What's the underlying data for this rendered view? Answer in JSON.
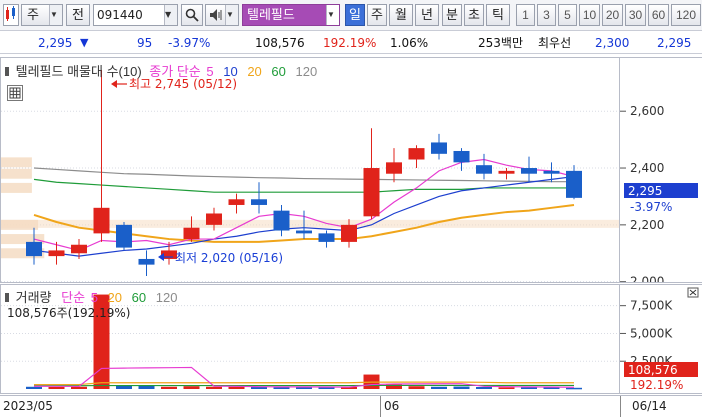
{
  "toolbar": {
    "market": "주",
    "prev_label": "전",
    "code_value": "091440",
    "stock_name": "텔레필드",
    "periods": [
      "일",
      "주",
      "월",
      "년",
      "분",
      "초",
      "틱"
    ],
    "selected_period": "일",
    "minutes": [
      "1",
      "3",
      "5",
      "10",
      "20",
      "30",
      "60",
      "120"
    ]
  },
  "quote": {
    "price": "2,295",
    "change": "95",
    "change_pct": "-3.97%",
    "volume": "108,576",
    "vol_ratio": "192.19%",
    "turnover": "1.06%",
    "amount": "253백만",
    "bid_label": "최우선",
    "bid": "2,300",
    "ask": "2,295"
  },
  "price_panel": {
    "legend_title": "텔레필드 매물대 수(10)",
    "legend_ma_label": "종가 단순",
    "ma_periods": [
      "5",
      "10",
      "20",
      "60",
      "120"
    ],
    "ma_colors": [
      "#e73bd1",
      "#1d3fcf",
      "#f0a51a",
      "#1f9c39",
      "#8c8c8c"
    ],
    "high_annotation": "최고 2,745 (05/12)",
    "low_annotation": "최저 2,020 (05/16)",
    "axis_ticks": [
      "2,600",
      "2,400",
      "2,200",
      "2,000"
    ],
    "current_price_tag": "2,295",
    "current_pct": "-3.97%"
  },
  "volume_panel": {
    "legend_title": "거래량",
    "legend_ma_label": "단순",
    "ma_periods": [
      "5",
      "20",
      "60",
      "120"
    ],
    "ma_colors": [
      "#e73bd1",
      "#f0a51a",
      "#1f9c39",
      "#8c8c8c"
    ],
    "current_volume_text": "108,576주(192.19%)",
    "axis_ticks": [
      "7,500K",
      "5,000K",
      "2,500K"
    ],
    "current_volume_tag": "108,576",
    "current_volume_pct": "192.19%"
  },
  "date_axis": {
    "labels": [
      "2023/05",
      "06"
    ],
    "last_date": "06/14"
  },
  "colors": {
    "up": "#e0231b",
    "down": "#1a5fc9",
    "accent": "#3b6fd8",
    "volume_profile": "#f5dcc3"
  },
  "chart_data": {
    "type": "candlestick",
    "price_axis_ticks": [
      2000,
      2200,
      2400,
      2600
    ],
    "candles": [
      {
        "o": 2140,
        "h": 2190,
        "l": 2060,
        "c": 2090
      },
      {
        "o": 2090,
        "h": 2140,
        "l": 2060,
        "c": 2110
      },
      {
        "o": 2100,
        "h": 2150,
        "l": 2080,
        "c": 2130
      },
      {
        "o": 2170,
        "h": 2745,
        "l": 2140,
        "c": 2260
      },
      {
        "o": 2200,
        "h": 2210,
        "l": 2110,
        "c": 2120
      },
      {
        "o": 2080,
        "h": 2110,
        "l": 2020,
        "c": 2060
      },
      {
        "o": 2080,
        "h": 2140,
        "l": 2060,
        "c": 2110
      },
      {
        "o": 2150,
        "h": 2230,
        "l": 2140,
        "c": 2190
      },
      {
        "o": 2200,
        "h": 2260,
        "l": 2180,
        "c": 2240
      },
      {
        "o": 2270,
        "h": 2310,
        "l": 2240,
        "c": 2290
      },
      {
        "o": 2290,
        "h": 2350,
        "l": 2240,
        "c": 2270
      },
      {
        "o": 2250,
        "h": 2270,
        "l": 2160,
        "c": 2180
      },
      {
        "o": 2180,
        "h": 2250,
        "l": 2150,
        "c": 2170
      },
      {
        "o": 2170,
        "h": 2180,
        "l": 2120,
        "c": 2140
      },
      {
        "o": 2140,
        "h": 2220,
        "l": 2120,
        "c": 2200
      },
      {
        "o": 2230,
        "h": 2540,
        "l": 2220,
        "c": 2400
      },
      {
        "o": 2380,
        "h": 2470,
        "l": 2350,
        "c": 2420
      },
      {
        "o": 2430,
        "h": 2480,
        "l": 2400,
        "c": 2470
      },
      {
        "o": 2490,
        "h": 2520,
        "l": 2430,
        "c": 2450
      },
      {
        "o": 2460,
        "h": 2470,
        "l": 2390,
        "c": 2420
      },
      {
        "o": 2410,
        "h": 2450,
        "l": 2360,
        "c": 2380
      },
      {
        "o": 2380,
        "h": 2400,
        "l": 2360,
        "c": 2390
      },
      {
        "o": 2400,
        "h": 2440,
        "l": 2350,
        "c": 2380
      },
      {
        "o": 2390,
        "h": 2420,
        "l": 2350,
        "c": 2380
      },
      {
        "o": 2390,
        "h": 2410,
        "l": 2290,
        "c": 2295
      }
    ],
    "ma5": [
      2150,
      2130,
      2110,
      2145,
      2140,
      2145,
      2130,
      2150,
      2150,
      2190,
      2230,
      2240,
      2230,
      2205,
      2190,
      2220,
      2280,
      2330,
      2390,
      2420,
      2430,
      2410,
      2395,
      2390,
      2370
    ],
    "ma10": [
      2110,
      2100,
      2090,
      2100,
      2110,
      2115,
      2125,
      2135,
      2150,
      2160,
      2175,
      2185,
      2190,
      2185,
      2180,
      2200,
      2240,
      2270,
      2300,
      2320,
      2330,
      2340,
      2350,
      2360,
      2370
    ],
    "ma20": [
      2235,
      2210,
      2190,
      2180,
      2170,
      2160,
      2150,
      2145,
      2140,
      2140,
      2140,
      2145,
      2150,
      2150,
      2150,
      2160,
      2175,
      2190,
      2210,
      2225,
      2235,
      2245,
      2250,
      2260,
      2270
    ],
    "ma60": [
      2360,
      2350,
      2345,
      2340,
      2335,
      2330,
      2325,
      2320,
      2315,
      2315,
      2315,
      2315,
      2315,
      2315,
      2315,
      2315,
      2320,
      2325,
      2325,
      2325,
      2330,
      2330,
      2330,
      2330,
      2330
    ],
    "ma120": [
      2400,
      2395,
      2390,
      2385,
      2380,
      2378,
      2375,
      2372,
      2370,
      2368,
      2366,
      2365,
      2363,
      2362,
      2361,
      2360,
      2359,
      2358,
      2357,
      2356,
      2355,
      2354,
      2353,
      2352,
      2352
    ],
    "volume_profile": [
      {
        "price": 2420,
        "vol": 0.05
      },
      {
        "price": 2380,
        "vol": 0.05
      },
      {
        "price": 2330,
        "vol": 0.05
      },
      {
        "price": 2200,
        "vol": 0.06
      },
      {
        "price": 2150,
        "vol": 0.07
      },
      {
        "price": 2100,
        "vol": 0.07
      }
    ],
    "volume_axis_ticks": [
      2500,
      5000,
      7500
    ],
    "volume_k": [
      200,
      180,
      200,
      8500,
      300,
      350,
      200,
      250,
      200,
      200,
      180,
      150,
      200,
      150,
      180,
      1300,
      400,
      250,
      200,
      220,
      180,
      150,
      150,
      180,
      108
    ],
    "vol_ma5": [
      250,
      240,
      230,
      1850,
      1880,
      1900,
      1920,
      1940,
      260,
      240,
      210,
      190,
      190,
      180,
      170,
      400,
      450,
      460,
      470,
      480,
      240,
      210,
      190,
      180,
      160
    ],
    "vol_ma20": [
      400,
      400,
      400,
      560,
      560,
      560,
      560,
      560,
      560,
      560,
      560,
      560,
      560,
      560,
      560,
      620,
      620,
      620,
      620,
      620,
      600,
      560,
      560,
      560,
      560
    ],
    "vol_ma60": [
      300,
      300,
      300,
      310,
      310,
      310,
      310,
      310,
      310,
      310,
      310,
      310,
      310,
      310,
      310,
      320,
      320,
      320,
      320,
      320,
      320,
      320,
      320,
      320,
      320
    ]
  }
}
